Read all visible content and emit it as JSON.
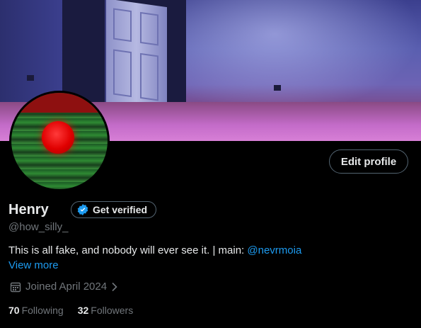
{
  "profile": {
    "name": "Henry",
    "handle": "@how_silly_",
    "bio_text": "This is all fake, and nobody will ever see it. | main: ",
    "bio_mention": "@nevrmoia",
    "view_more": "View more",
    "joined": "Joined April 2024",
    "following_count": "70",
    "following_label": "Following",
    "followers_count": "32",
    "followers_label": "Followers"
  },
  "buttons": {
    "edit_profile": "Edit profile",
    "get_verified": "Get verified"
  },
  "icons": [
    "verified-badge-icon",
    "calendar-icon",
    "chevron-right-icon"
  ],
  "colors": {
    "accent": "#1d9bf0",
    "muted": "#71767b",
    "background": "#000000"
  }
}
